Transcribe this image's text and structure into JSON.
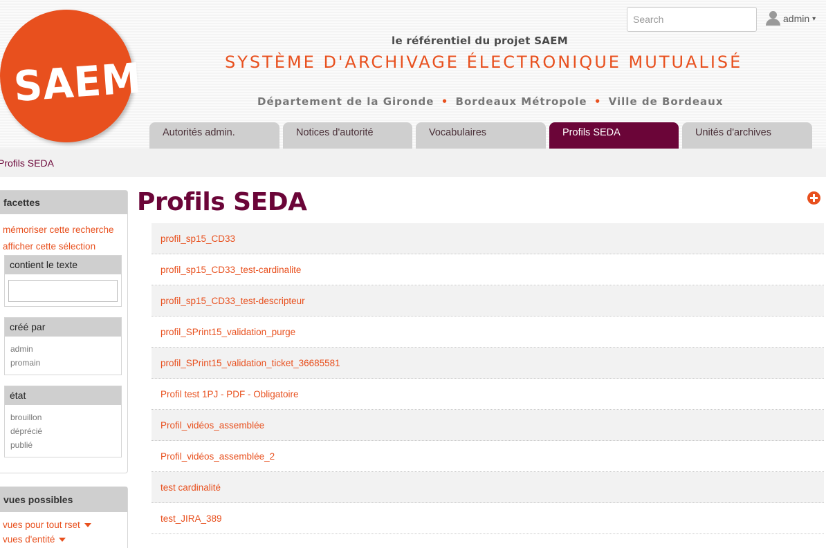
{
  "header": {
    "logo_text": "SAEM",
    "tagline": "le référentiel du projet SAEM",
    "system_name": "SYSTÈME D'ARCHIVAGE ÉLECTRONIQUE MUTUALISÉ",
    "partners": [
      "Département de la Gironde",
      "Bordeaux Métropole",
      "Ville de Bordeaux"
    ],
    "partner_separator": "•",
    "search_placeholder": "Search",
    "user": "admin",
    "user_caret": "▾"
  },
  "tabs": [
    {
      "label": "Autorités admin.",
      "active": false
    },
    {
      "label": "Notices d'autorité",
      "active": false
    },
    {
      "label": "Vocabulaires",
      "active": false
    },
    {
      "label": "Profils SEDA",
      "active": true
    },
    {
      "label": "Unités d'archives",
      "active": false
    }
  ],
  "breadcrumb": "Profils SEDA",
  "sidebar": {
    "facets_title": "facettes",
    "save_search": "mémoriser cette recherche",
    "show_selection": "afficher cette sélection",
    "text_facet_title": "contient le texte",
    "created_by": {
      "title": "créé par",
      "items": [
        "admin",
        "promain"
      ]
    },
    "state": {
      "title": "état",
      "items": [
        "brouillon",
        "déprécié",
        "publié"
      ]
    },
    "views_title": "vues possibles",
    "views": [
      "vues pour tout rset",
      "vues d'entité"
    ]
  },
  "main": {
    "title": "Profils SEDA",
    "profiles": [
      "profil_sp15_CD33",
      "profil_sp15_CD33_test-cardinalite",
      "profil_sp15_CD33_test-descripteur",
      "profil_SPrint15_validation_purge",
      "profil_SPrint15_validation_ticket_36685581",
      "Profil test 1PJ - PDF - Obligatoire",
      "Profil_vidéos_assemblée",
      "Profil_vidéos_assemblée_2",
      "test cardinalité",
      "test_JIRA_389"
    ]
  },
  "colors": {
    "brand_orange": "#e8501e",
    "brand_purple": "#6b0538",
    "tab_gray": "#cfcfcf"
  },
  "icons": {
    "user": "user-icon",
    "add": "plus-circle-icon",
    "caret": "caret-down-icon"
  }
}
